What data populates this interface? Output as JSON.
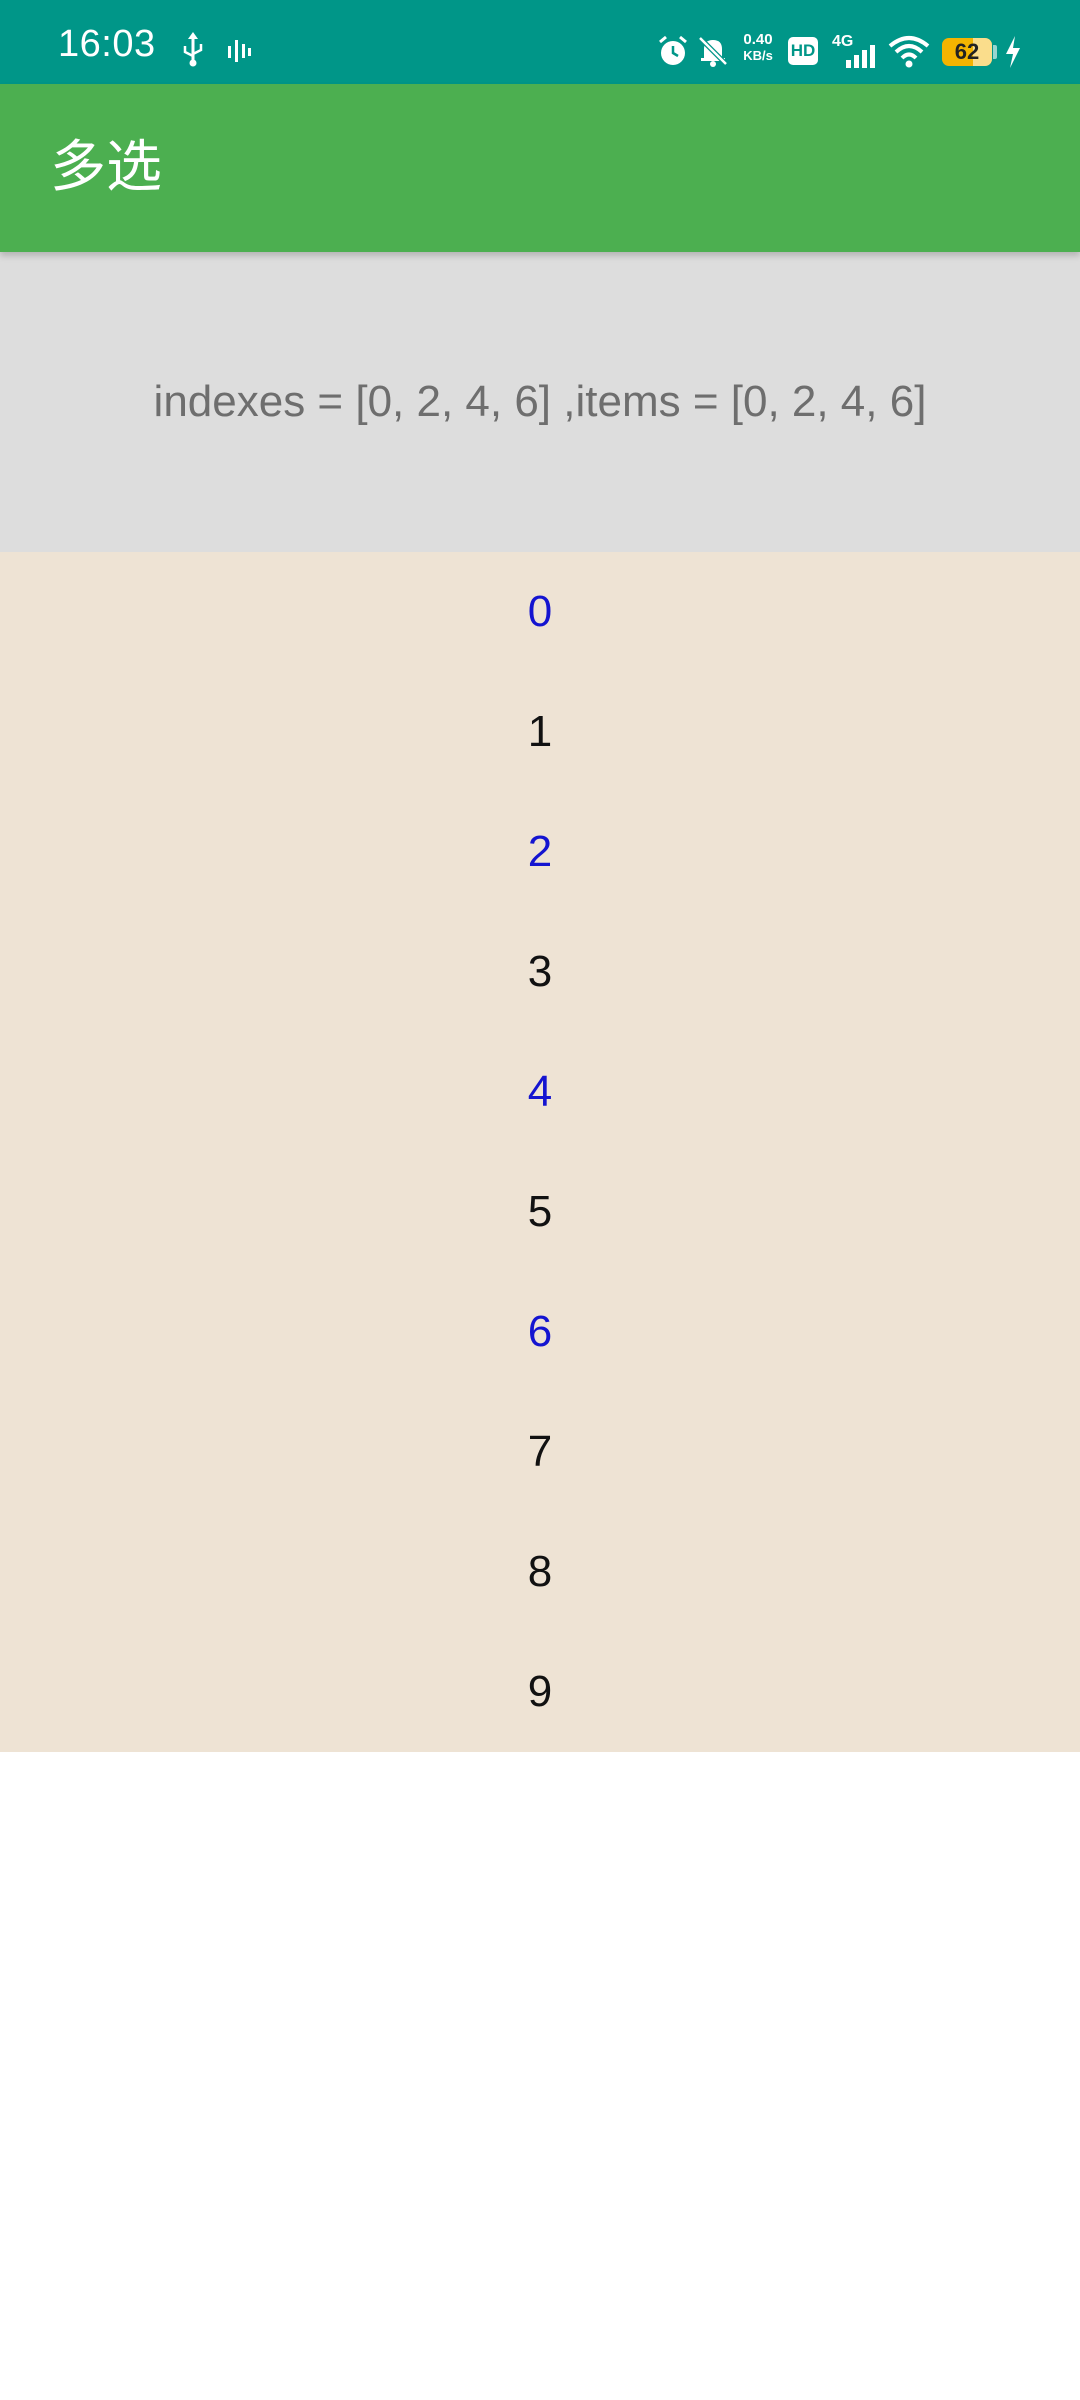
{
  "status_bar": {
    "time": "16:03",
    "icons": [
      "usb-icon",
      "signal-bars-icon",
      "alarm-icon",
      "bell-off-icon",
      "wifi-icon",
      "charging-icon"
    ],
    "net_speed_value": "0.40",
    "net_speed_unit": "KB/s",
    "hd_badge": "HD",
    "net_type": "4G",
    "battery_level": "62",
    "battery_color": "#f4b400",
    "background": "#009688"
  },
  "app_bar": {
    "title": "多选",
    "background": "#4caf50"
  },
  "summary": {
    "text": "indexes = [0, 2, 4, 6] ,items = [0, 2, 4, 6]",
    "background": "#dddddd"
  },
  "list": {
    "background": "#eee3d4",
    "selected_color": "#1414d0",
    "unselected_color": "#111111",
    "items": [
      {
        "label": "0",
        "selected": true
      },
      {
        "label": "1",
        "selected": false
      },
      {
        "label": "2",
        "selected": true
      },
      {
        "label": "3",
        "selected": false
      },
      {
        "label": "4",
        "selected": true
      },
      {
        "label": "5",
        "selected": false
      },
      {
        "label": "6",
        "selected": true
      },
      {
        "label": "7",
        "selected": false
      },
      {
        "label": "8",
        "selected": false
      },
      {
        "label": "9",
        "selected": false
      }
    ]
  }
}
